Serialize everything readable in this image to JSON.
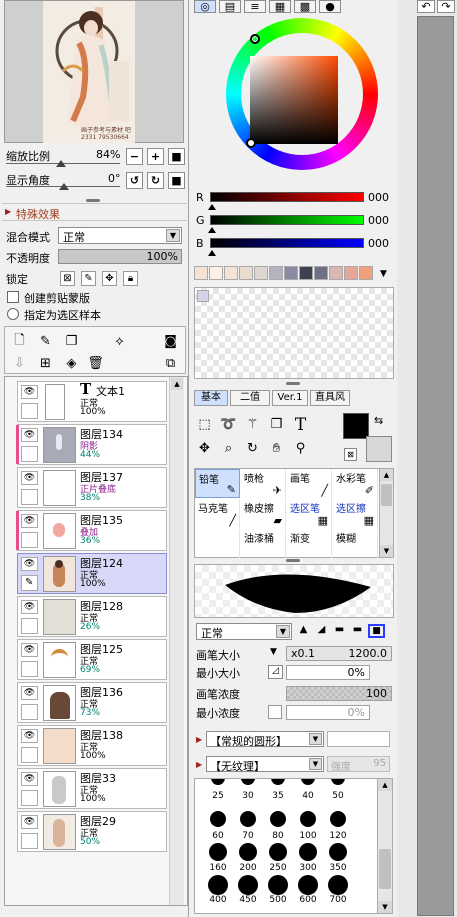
{
  "navigator": {
    "zoom_label": "缩放比例",
    "zoom_value": "84%",
    "angle_label": "显示角度",
    "angle_value": "0°",
    "zoom_minus": "−",
    "zoom_plus": "+",
    "zoom_reset": "■",
    "rotate_left": "↺",
    "rotate_right": "↻",
    "rotate_reset": "■",
    "artwork_caption_1": "画子参考与素材 吧",
    "artwork_caption_2": "2331 79530664"
  },
  "effects": {
    "header": "特殊效果"
  },
  "layer_props": {
    "blend_label": "混合模式",
    "blend_value": "正常",
    "opacity_label": "不透明度",
    "opacity_value": "100%",
    "opacity_fill": 1.0,
    "lock_label": "锁定",
    "clip_label": "创建剪贴蒙版",
    "select_source_label": "指定为选区样本"
  },
  "layers": [
    {
      "name": "文本1",
      "mode": "正常",
      "opacity": "100%",
      "type": "text",
      "clip": false,
      "mode_color": "#000000",
      "op_color": "#000000",
      "selected": false
    },
    {
      "name": "图层134",
      "mode": "阴影",
      "opacity": "44%",
      "clip": true,
      "mode_color": "#8a1c8a",
      "op_color": "#008070",
      "selected": false
    },
    {
      "name": "图层137",
      "mode": "正片叠底",
      "opacity": "38%",
      "clip": false,
      "mode_color": "#8a1c8a",
      "op_color": "#008070",
      "selected": false
    },
    {
      "name": "图层135",
      "mode": "叠加",
      "opacity": "36%",
      "clip": true,
      "mode_color": "#8a1c8a",
      "op_color": "#008070",
      "selected": false
    },
    {
      "name": "图层124",
      "mode": "正常",
      "opacity": "100%",
      "clip": false,
      "mode_color": "#000000",
      "op_color": "#000000",
      "selected": true
    },
    {
      "name": "图层128",
      "mode": "正常",
      "opacity": "26%",
      "clip": false,
      "mode_color": "#000000",
      "op_color": "#008070",
      "selected": false
    },
    {
      "name": "图层125",
      "mode": "正常",
      "opacity": "69%",
      "clip": false,
      "mode_color": "#000000",
      "op_color": "#008070",
      "selected": false
    },
    {
      "name": "图层136",
      "mode": "正常",
      "opacity": "73%",
      "clip": false,
      "mode_color": "#000000",
      "op_color": "#008070",
      "selected": false
    },
    {
      "name": "图层138",
      "mode": "正常",
      "opacity": "100%",
      "clip": false,
      "mode_color": "#000000",
      "op_color": "#000000",
      "selected": false
    },
    {
      "name": "图层33",
      "mode": "正常",
      "opacity": "100%",
      "clip": false,
      "mode_color": "#000000",
      "op_color": "#000000",
      "selected": false
    },
    {
      "name": "图层29",
      "mode": "正常",
      "opacity": "50%",
      "clip": false,
      "mode_color": "#000000",
      "op_color": "#008070",
      "selected": false
    }
  ],
  "color": {
    "r_label": "R",
    "g_label": "G",
    "b_label": "B",
    "r_value": "000",
    "g_value": "000",
    "b_value": "000",
    "swatches": [
      "#f6e2d2",
      "#fbeee4",
      "#f3e4d6",
      "#e9dccd",
      "#ddd5cf",
      "#b4b3c1",
      "#8c8aa0",
      "#3d4150",
      "#6e7085",
      "#d9b6b0",
      "#e6a79b",
      "#f0a07a"
    ]
  },
  "tools": {
    "tabs": [
      "基本",
      "二值",
      "Ver.1",
      "直具风"
    ],
    "brushes": [
      {
        "label": "铅笔",
        "icon": "✎",
        "active": true
      },
      {
        "label": "喷枪",
        "icon": "✈",
        "active": false
      },
      {
        "label": "画笔",
        "icon": "╱",
        "active": false
      },
      {
        "label": "水彩笔",
        "icon": "✐",
        "active": false
      },
      {
        "label": "马克笔",
        "icon": "╱",
        "active": false
      },
      {
        "label": "橡皮擦",
        "icon": "▰",
        "active": false
      },
      {
        "label": "选区笔",
        "icon": "▦",
        "active": false,
        "blue": true
      },
      {
        "label": "选区擦",
        "icon": "▦",
        "active": false,
        "blue": true
      },
      {
        "label": "",
        "icon": "",
        "active": false
      },
      {
        "label": "油漆桶",
        "icon": "",
        "active": false
      },
      {
        "label": "渐变",
        "icon": "",
        "active": false
      },
      {
        "label": "模糊",
        "icon": "",
        "active": false
      }
    ]
  },
  "brush_settings": {
    "mode_value": "正常",
    "size_label": "画笔大小",
    "size_mult": "x0.1",
    "size_value": "1200.0",
    "min_size_label": "最小大小",
    "min_size_value": "0%",
    "density_label": "画笔浓度",
    "density_value": "100",
    "min_density_label": "最小浓度",
    "min_density_value": "0%",
    "shape_value": "【常规的圆形】",
    "texture_value": "【无纹理】",
    "texture_strength_label": "强度",
    "texture_strength_value": "95",
    "size_rows": [
      [
        "25",
        "30",
        "35",
        "40",
        "50"
      ],
      [
        "60",
        "70",
        "80",
        "100",
        "120"
      ],
      [
        "160",
        "200",
        "250",
        "300",
        "350"
      ],
      [
        "400",
        "450",
        "500",
        "600",
        "700"
      ]
    ]
  }
}
